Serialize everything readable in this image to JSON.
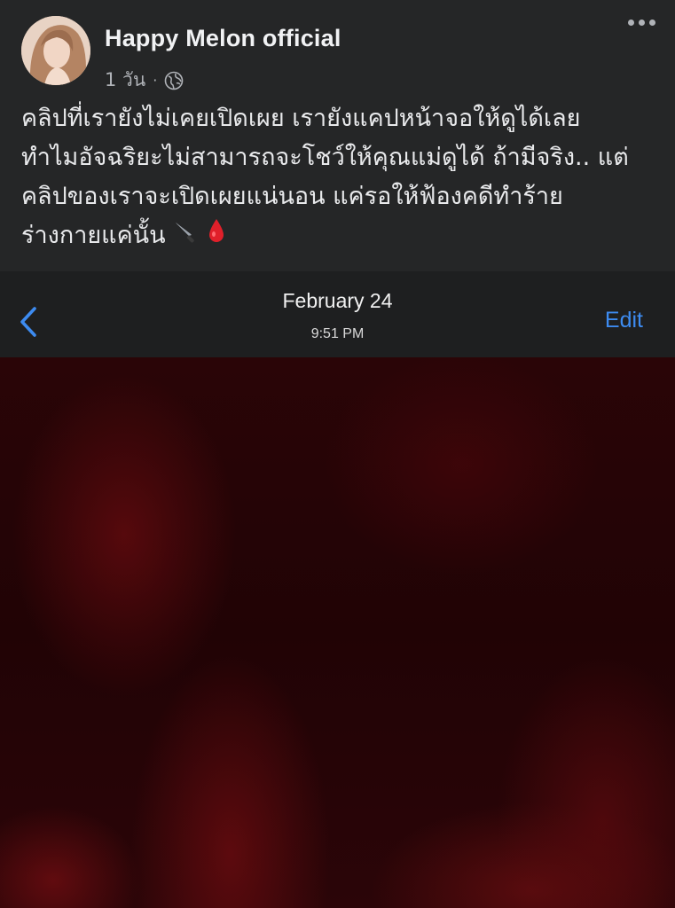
{
  "post": {
    "author": "Happy Melon official",
    "time": "1 วัน",
    "separator": "·",
    "privacy_icon": "globe-icon",
    "more_icon": "more-dots-icon",
    "text_lines": [
      "คลิปที่เรายังไม่เคยเปิดเผย เรายังแคปหน้าจอให้ดูได้เลย",
      "ทำไมอัจฉริยะไม่สามารถจะโชว์ให้คุณแม่ดูได้ ถ้ามีจริง.. แต่",
      "คลิปของเราจะเปิดเผยแน่นอน แค่รอให้ฟ้องคดีทำร้าย",
      "ร่างกายแค่นั้น"
    ],
    "emojis": [
      "knife-emoji",
      "drop-of-blood-emoji"
    ]
  },
  "photo_viewer": {
    "back_icon": "chevron-left-icon",
    "date": "February 24",
    "time": "9:51 PM",
    "edit_label": "Edit",
    "accent_color": "#3d8bf0"
  }
}
